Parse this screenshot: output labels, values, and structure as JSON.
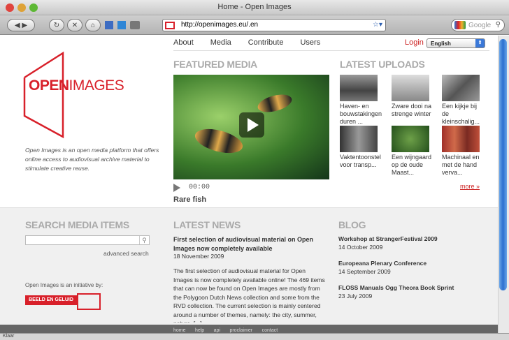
{
  "browser": {
    "title": "Home - Open Images",
    "url": "http://openimages.eu/.en",
    "search_placeholder": "Google",
    "status": "Klaar"
  },
  "nav": {
    "items": [
      "About",
      "Media",
      "Contribute",
      "Users"
    ],
    "login": "Login",
    "language": "English"
  },
  "logo": {
    "text_bold": "OPEN",
    "text_light": "IMAGES"
  },
  "intro": "Open Images is an open media platform that offers online access to audiovisual archive material to stimulate creative reuse.",
  "featured": {
    "heading": "FEATURED MEDIA",
    "time": "00:00",
    "caption": "Rare fish"
  },
  "uploads": {
    "heading": "LATEST UPLOADS",
    "items": [
      {
        "label": "Haven- en bouwstakingen duren ..."
      },
      {
        "label": "Zware dooi na strenge winter"
      },
      {
        "label": "Een kijkje bij de kleinschalig..."
      },
      {
        "label": "Vaktentoonstel voor transp..."
      },
      {
        "label": "Een wijngaard op de oude Maast..."
      },
      {
        "label": "Machinaal en met de hand verva..."
      }
    ],
    "more": "more »"
  },
  "search": {
    "heading": "SEARCH MEDIA ITEMS",
    "advanced": "advanced search",
    "initiative": "Open Images is an initiative by:",
    "partner": "BEELD EN GELUID"
  },
  "news": {
    "heading": "LATEST NEWS",
    "title": "First selection of audiovisual material on Open Images now completely available",
    "date": "18 November 2009",
    "body": "The first selection of audiovisual material for Open Images is now completely available online! The 469 items that can now be found on Open Images are mostly from the Polygoon Dutch News collection and some from the RVD collection. The current selection is mainly centered around a number of themes, namely: the city, summer, nature, [...]"
  },
  "blog": {
    "heading": "BLOG",
    "posts": [
      {
        "title": "Workshop at StrangerFestival 2009",
        "date": "14 October 2009"
      },
      {
        "title": "Europeana Plenary Conference",
        "date": "14 September 2009"
      },
      {
        "title": "FLOSS Manuals Ogg Theora Book Sprint",
        "date": "23 July 2009"
      }
    ]
  },
  "footer": {
    "links": [
      "home",
      "help",
      "api",
      "proclaimer",
      "contact"
    ]
  },
  "colors": {
    "brand_red": "#d8202a",
    "link_red": "#cc2222"
  }
}
